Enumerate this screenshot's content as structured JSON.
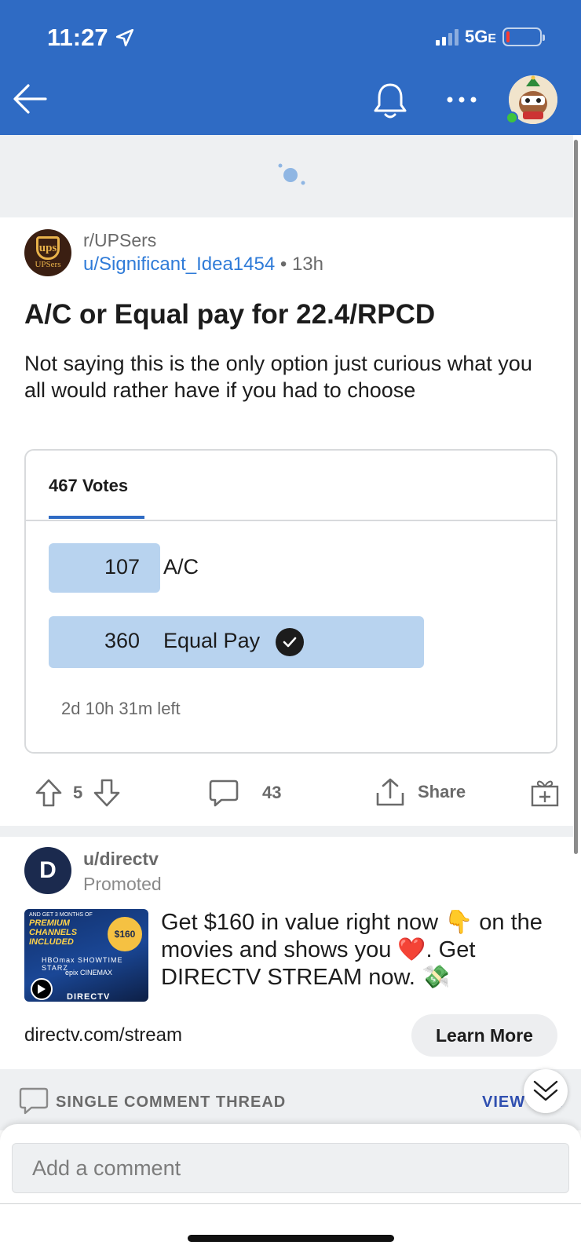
{
  "status_bar": {
    "time": "11:27",
    "network": "5G",
    "network_suffix": "E"
  },
  "post": {
    "subreddit": "r/UPSers",
    "author": "u/Significant_Idea1454",
    "separator": "•",
    "age": "13h",
    "title": "A/C or Equal pay for 22.4/RPCD",
    "body": "Not saying this is the only option just curious what you all would rather have if you had to choose",
    "subreddit_avatar_text": "ups",
    "subreddit_avatar_subtext": "UPSers"
  },
  "poll": {
    "tab_label": "467 Votes",
    "options": [
      {
        "count": "107",
        "label": "A/C",
        "fraction": 0.229,
        "selected": false
      },
      {
        "count": "360",
        "label": "Equal Pay",
        "fraction": 0.771,
        "selected": true
      }
    ],
    "time_left": "2d 10h 31m left",
    "bar_color": "#b8d3ef"
  },
  "actions": {
    "score": "5",
    "comments": "43",
    "share_label": "Share"
  },
  "ad": {
    "user": "u/directv",
    "promoted_label": "Promoted",
    "avatar_letter": "D",
    "text": "Get $160 in value right now 👇 on the movies and shows you ❤️. Get DIRECTV STREAM now. 💸",
    "url": "directv.com/stream",
    "cta": "Learn More",
    "thumb": {
      "small_top": "AND GET 3 MONTHS OF",
      "headline": "PREMIUM CHANNELS INCLUDED",
      "badge": "$160",
      "logos_line1": "HBOmax SHOWTIME STARZ",
      "logos_line2": "epix CINEMAX",
      "brand": "DIRECTV"
    }
  },
  "thread": {
    "label": "SINGLE COMMENT THREAD",
    "view_all": "VIEW ALL"
  },
  "comment_box": {
    "placeholder": "Add a comment"
  },
  "colors": {
    "header_bg": "#2f6bc4",
    "link": "#2f7bd8",
    "poll_accent": "#2f6bc4"
  }
}
